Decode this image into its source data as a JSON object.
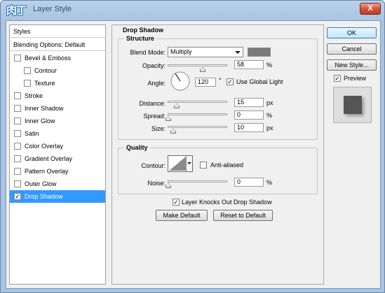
{
  "window": {
    "title": "Layer Style",
    "close_label": "X",
    "logo_text": "肉丁"
  },
  "styles_list": {
    "header": "Styles",
    "blending": "Blending Options: Default",
    "items": [
      {
        "label": "Bevel & Emboss",
        "checked": false,
        "indent": false,
        "selected": false
      },
      {
        "label": "Contour",
        "checked": false,
        "indent": true,
        "selected": false
      },
      {
        "label": "Texture",
        "checked": false,
        "indent": true,
        "selected": false
      },
      {
        "label": "Stroke",
        "checked": false,
        "indent": false,
        "selected": false
      },
      {
        "label": "Inner Shadow",
        "checked": false,
        "indent": false,
        "selected": false
      },
      {
        "label": "Inner Glow",
        "checked": false,
        "indent": false,
        "selected": false
      },
      {
        "label": "Satin",
        "checked": false,
        "indent": false,
        "selected": false
      },
      {
        "label": "Color Overlay",
        "checked": false,
        "indent": false,
        "selected": false
      },
      {
        "label": "Gradient Overlay",
        "checked": false,
        "indent": false,
        "selected": false
      },
      {
        "label": "Pattern Overlay",
        "checked": false,
        "indent": false,
        "selected": false
      },
      {
        "label": "Outer Glow",
        "checked": false,
        "indent": false,
        "selected": false
      },
      {
        "label": "Drop Shadow",
        "checked": true,
        "indent": false,
        "selected": true
      }
    ],
    "check_mark": "✓"
  },
  "drop_shadow": {
    "title": "Drop Shadow",
    "structure": {
      "title": "Structure",
      "blend_mode_label": "Blend Mode:",
      "blend_mode_value": "Multiply",
      "shadow_color": "#7a7a7a",
      "opacity_label": "Opacity:",
      "opacity_value": "58",
      "opacity_unit": "%",
      "angle_label": "Angle:",
      "angle_value": "120",
      "angle_unit": "°",
      "use_global_light_label": "Use Global Light",
      "use_global_light": true,
      "distance_label": "Distance:",
      "distance_value": "15",
      "distance_unit": "px",
      "spread_label": "Spread:",
      "spread_value": "0",
      "spread_unit": "%",
      "size_label": "Size:",
      "size_value": "10",
      "size_unit": "px"
    },
    "quality": {
      "title": "Quality",
      "contour_label": "Contour:",
      "anti_aliased_label": "Anti-aliased",
      "anti_aliased": false,
      "noise_label": "Noise:",
      "noise_value": "0",
      "noise_unit": "%"
    },
    "knockout_label": "Layer Knocks Out Drop Shadow",
    "knockout": true,
    "make_default_label": "Make Default",
    "reset_default_label": "Reset to Default"
  },
  "buttons": {
    "ok": "OK",
    "cancel": "Cancel",
    "new_style": "New Style...",
    "preview_label": "Preview",
    "preview_checked": true
  }
}
